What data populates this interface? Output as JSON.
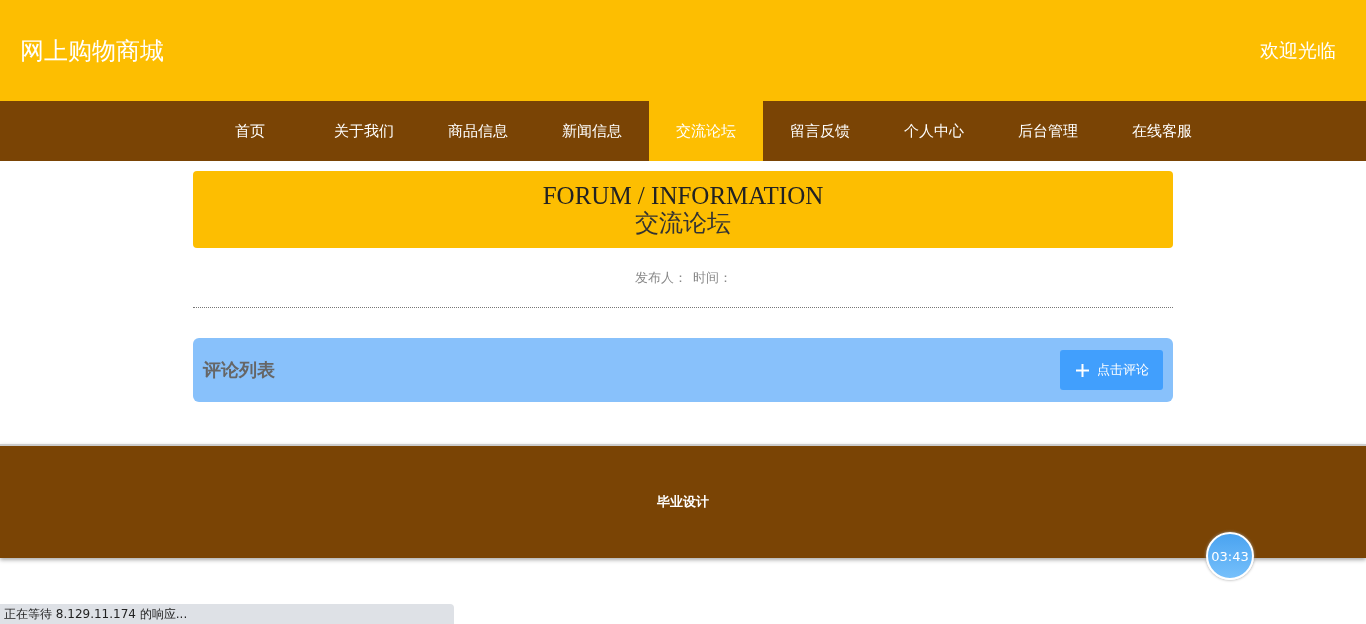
{
  "header": {
    "title": "网上购物商城",
    "welcome": "欢迎光临"
  },
  "nav": [
    {
      "label": "首页",
      "selected": false
    },
    {
      "label": "关于我们",
      "selected": false
    },
    {
      "label": "商品信息",
      "selected": false
    },
    {
      "label": "新闻信息",
      "selected": false
    },
    {
      "label": "交流论坛",
      "selected": true
    },
    {
      "label": "留言反馈",
      "selected": false
    },
    {
      "label": "个人中心",
      "selected": false
    },
    {
      "label": "后台管理",
      "selected": false
    },
    {
      "label": "在线客服",
      "selected": false
    }
  ],
  "banner": {
    "title_en": "FORUM / INFORMATION",
    "title_zh": "交流论坛"
  },
  "meta": {
    "author_label": "发布人：",
    "time_label": "时间："
  },
  "comments": {
    "title": "评论列表",
    "button": "点击评论"
  },
  "footer": {
    "text": "毕业设计"
  },
  "timer": "03:43",
  "status_bar": "正在等待 8.129.11.174 的响应..."
}
